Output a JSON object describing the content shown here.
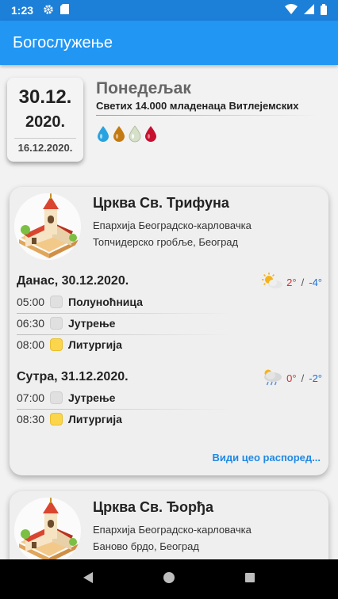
{
  "status": {
    "time": "1:23",
    "left_icons": [
      "gear-icon",
      "sd-card-icon"
    ],
    "right_icons": [
      "wifi-icon",
      "signal-icon",
      "battery-icon"
    ]
  },
  "app_bar": {
    "title": "Богослужење"
  },
  "date": {
    "day_month": "30.12.",
    "year": "2020.",
    "old_calendar": "16.12.2020.",
    "weekday": "Понедељак",
    "saint": "Светих 14.000 младенаца Витлејемских",
    "fasting_drops": [
      {
        "icon": "water-drop-icon",
        "color": "#29a3e0"
      },
      {
        "icon": "oil-drop-icon",
        "color": "#c47a12"
      },
      {
        "icon": "milk-drop-icon",
        "color": "#c8d6b8"
      },
      {
        "icon": "wine-drop-icon",
        "color": "#c8102e"
      }
    ]
  },
  "churches": [
    {
      "name": "Црква Св. Трифуна",
      "eparchy": "Епархија Београдско-карловачка",
      "location": "Топчидерско гробље, Београд",
      "days": [
        {
          "label": "Данас, 30.12.2020.",
          "weather_icon": "sun-cloud-icon",
          "temp_high": "2°",
          "temp_sep": "/",
          "temp_low": "-4°",
          "services": [
            {
              "time": "05:00",
              "name": "Полуноћница",
              "type": "grey"
            },
            {
              "time": "06:30",
              "name": "Јутрење",
              "type": "grey"
            },
            {
              "time": "08:00",
              "name": "Литургија",
              "type": "gold"
            }
          ]
        },
        {
          "label": "Сутра, 31.12.2020.",
          "weather_icon": "rain-cloud-icon",
          "temp_high": "0°",
          "temp_sep": "/",
          "temp_low": "-2°",
          "services": [
            {
              "time": "07:00",
              "name": "Јутрење",
              "type": "grey"
            },
            {
              "time": "08:30",
              "name": "Литургија",
              "type": "gold"
            }
          ]
        }
      ],
      "see_all": "Види цео распоред..."
    },
    {
      "name": "Црква Св. Ђорђа",
      "eparchy": "Епархија Београдско-карловачка",
      "location": "Баново брдо, Београд"
    }
  ],
  "nav": {
    "back": "back-icon",
    "home": "home-icon",
    "recents": "recents-icon"
  }
}
